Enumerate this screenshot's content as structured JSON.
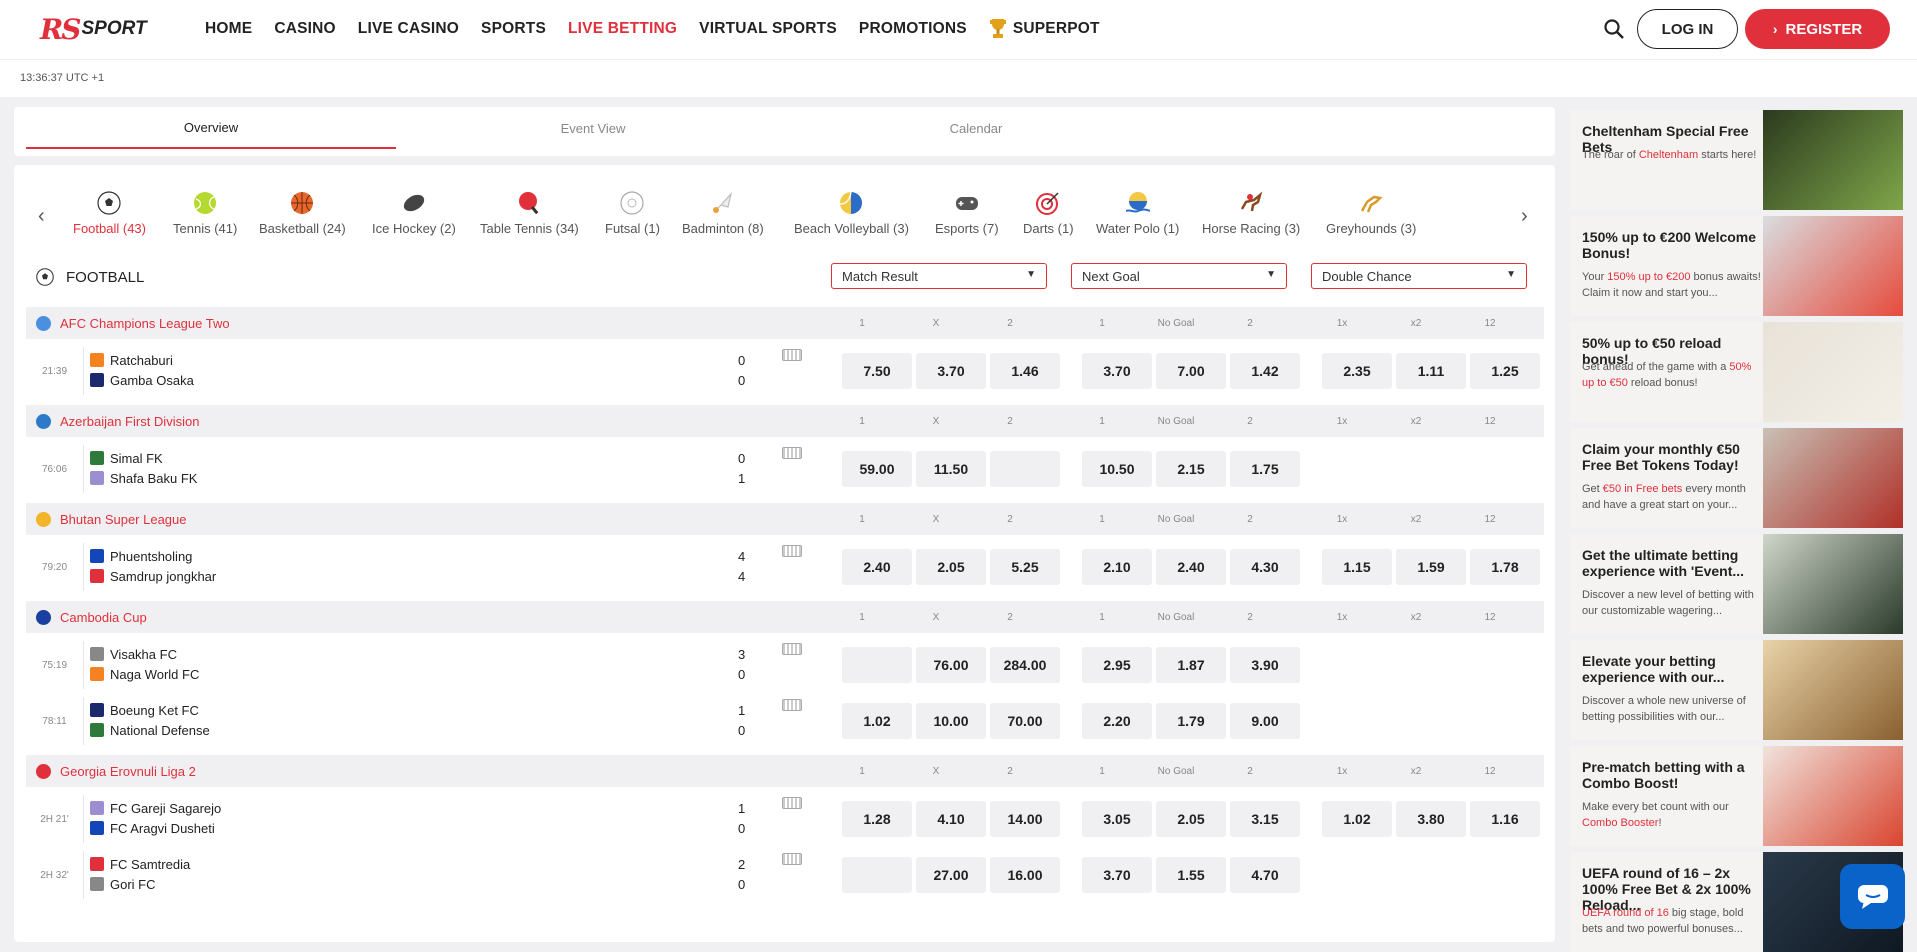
{
  "brand": {
    "logo_rs": "RS",
    "logo_sport": "SPORT",
    "accent": "#e0303c"
  },
  "nav": {
    "items": [
      "HOME",
      "CASINO",
      "LIVE CASINO",
      "SPORTS",
      "LIVE BETTING",
      "VIRTUAL SPORTS",
      "PROMOTIONS",
      "SUPERPOT"
    ],
    "active": "LIVE BETTING"
  },
  "auth": {
    "login": "LOG IN",
    "register": "REGISTER"
  },
  "clock": "13:36:37 UTC +1",
  "view_tabs": [
    "Overview",
    "Event View",
    "Calendar"
  ],
  "sports": [
    {
      "label": "Football (43)",
      "icon": "football-icon"
    },
    {
      "label": "Tennis (41)",
      "icon": "tennis-icon"
    },
    {
      "label": "Basketball (24)",
      "icon": "basketball-icon"
    },
    {
      "label": "Ice Hockey (2)",
      "icon": "ice-hockey-icon"
    },
    {
      "label": "Table Tennis (34)",
      "icon": "table-tennis-icon"
    },
    {
      "label": "Futsal (1)",
      "icon": "futsal-icon"
    },
    {
      "label": "Badminton (8)",
      "icon": "badminton-icon"
    },
    {
      "label": "Beach Volleyball (3)",
      "icon": "beach-volleyball-icon"
    },
    {
      "label": "Esports (7)",
      "icon": "esports-icon"
    },
    {
      "label": "Darts (1)",
      "icon": "darts-icon"
    },
    {
      "label": "Water Polo (1)",
      "icon": "water-polo-icon"
    },
    {
      "label": "Horse Racing (3)",
      "icon": "horse-racing-icon"
    },
    {
      "label": "Greyhounds (3)",
      "icon": "greyhounds-icon"
    }
  ],
  "section": {
    "title": "FOOTBALL"
  },
  "markets": [
    "Match Result",
    "Next Goal",
    "Double Chance"
  ],
  "market_heads": [
    "1",
    "X",
    "2",
    "1",
    "No Goal",
    "2",
    "1x",
    "x2",
    "12"
  ],
  "leagues": [
    {
      "name": "AFC Champions League Two",
      "matches": [
        {
          "time": "21:39",
          "home": "Ratchaburi",
          "away": "Gamba Osaka",
          "sh": "0",
          "sa": "0",
          "odds": [
            "7.50",
            "3.70",
            "1.46",
            "3.70",
            "7.00",
            "1.42",
            "2.35",
            "1.11",
            "1.25"
          ]
        }
      ]
    },
    {
      "name": "Azerbaijan First Division",
      "matches": [
        {
          "time": "76:06",
          "home": "Simal FK",
          "away": "Shafa Baku FK",
          "sh": "0",
          "sa": "1",
          "odds": [
            "59.00",
            "11.50",
            "",
            "10.50",
            "2.15",
            "1.75"
          ]
        }
      ]
    },
    {
      "name": "Bhutan Super League",
      "matches": [
        {
          "time": "79:20",
          "home": "Phuentsholing",
          "away": "Samdrup jongkhar",
          "sh": "4",
          "sa": "4",
          "odds": [
            "2.40",
            "2.05",
            "5.25",
            "2.10",
            "2.40",
            "4.30",
            "1.15",
            "1.59",
            "1.78"
          ]
        }
      ]
    },
    {
      "name": "Cambodia Cup",
      "matches": [
        {
          "time": "75:19",
          "home": "Visakha FC",
          "away": "Naga World FC",
          "sh": "3",
          "sa": "0",
          "odds": [
            "",
            "76.00",
            "284.00",
            "2.95",
            "1.87",
            "3.90"
          ]
        },
        {
          "time": "78:11",
          "home": "Boeung Ket FC",
          "away": "National Defense",
          "sh": "1",
          "sa": "0",
          "odds": [
            "1.02",
            "10.00",
            "70.00",
            "2.20",
            "1.79",
            "9.00"
          ]
        }
      ]
    },
    {
      "name": "Georgia Erovnuli Liga 2",
      "matches": [
        {
          "time": "2H 21'",
          "home": "FC Gareji Sagarejo",
          "away": "FC Aragvi Dusheti",
          "sh": "1",
          "sa": "0",
          "odds": [
            "1.28",
            "4.10",
            "14.00",
            "3.05",
            "2.05",
            "3.15",
            "1.02",
            "3.80",
            "1.16"
          ]
        },
        {
          "time": "2H 32'",
          "home": "FC Samtredia",
          "away": "Gori FC",
          "sh": "2",
          "sa": "0",
          "odds": [
            "",
            "27.00",
            "16.00",
            "3.70",
            "1.55",
            "4.70"
          ]
        }
      ]
    }
  ],
  "promos": [
    {
      "title": "Cheltenham Special Free Bets",
      "desc_pre": "The roar of ",
      "desc_hl": "Cheltenham",
      "desc_post": " starts here!"
    },
    {
      "title": "150% up to €200 Welcome Bonus!",
      "desc_pre": "Your ",
      "desc_hl": "150% up to €200",
      "desc_post": " bonus awaits! Claim it now and start you..."
    },
    {
      "title": "50% up to €50 reload bonus!",
      "desc_pre": "Get ahead of the game with a ",
      "desc_hl": "50% up to €50",
      "desc_post": " reload bonus!"
    },
    {
      "title": "Claim your monthly €50 Free Bet Tokens Today!",
      "desc_pre": "Get ",
      "desc_hl": "€50 in Free bets",
      "desc_post": " every month and have a great start on your..."
    },
    {
      "title": "Get the ultimate betting experience with 'Event...",
      "desc_pre": "Discover a new level of betting with our customizable wagering...",
      "desc_hl": "",
      "desc_post": ""
    },
    {
      "title": "Elevate your betting experience with our...",
      "desc_pre": "Discover a whole new universe of betting possibilities with our...",
      "desc_hl": "",
      "desc_post": ""
    },
    {
      "title": "Pre-match betting with a Combo Boost!",
      "desc_pre": "Make every bet count with our ",
      "desc_hl": "Combo Booster",
      "desc_post": "!"
    },
    {
      "title": "UEFA round of 16 – 2x 100% Free Bet & 2x 100% Reload...",
      "desc_pre": "",
      "desc_hl": "UEFA round of 16",
      "desc_post": " big stage, bold bets and two powerful bonuses..."
    }
  ]
}
